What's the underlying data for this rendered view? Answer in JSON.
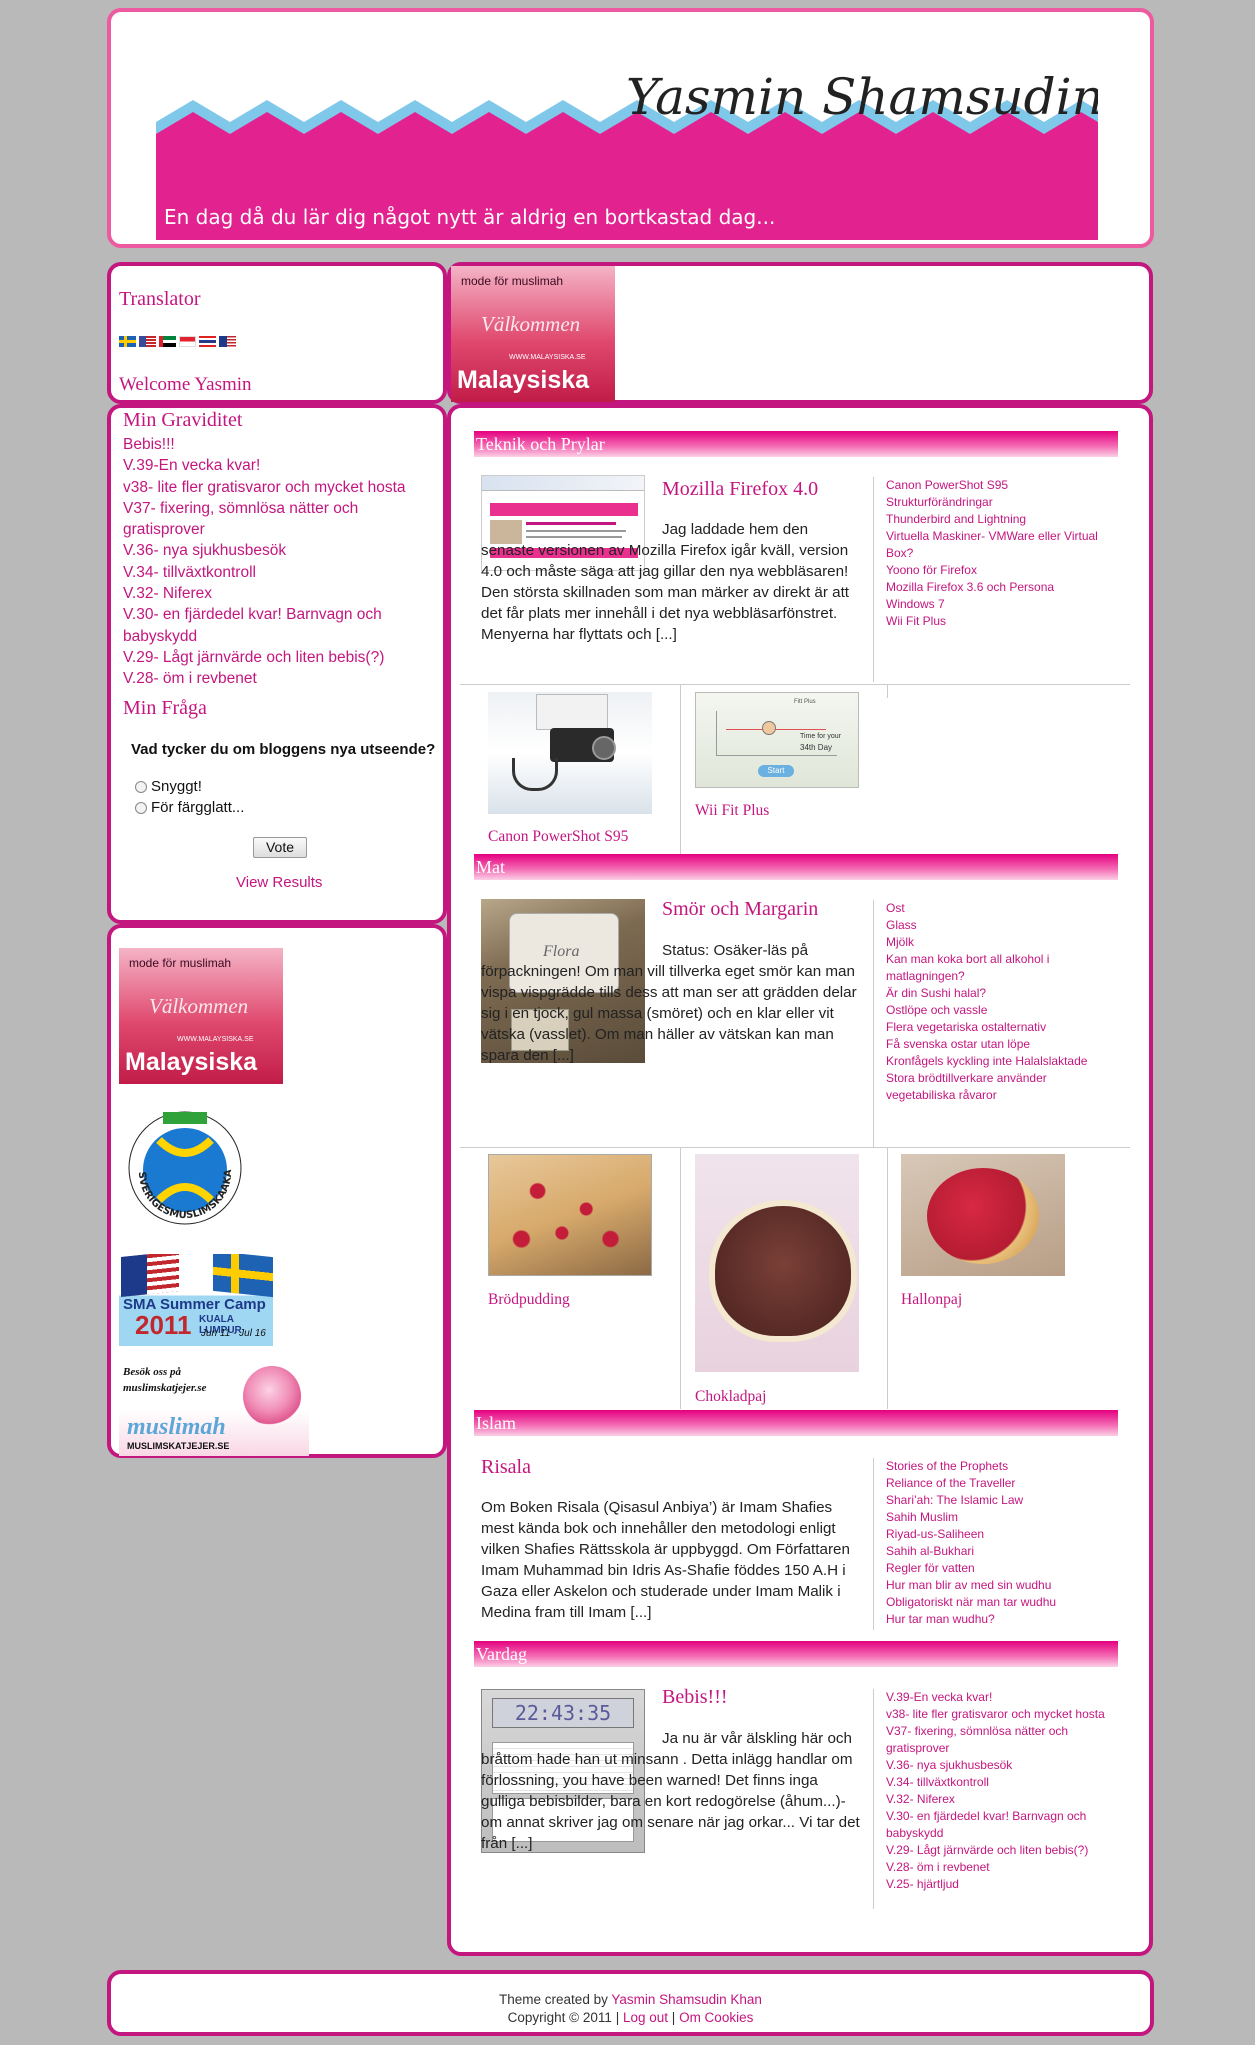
{
  "header": {
    "title": "Yasmin Shamsudin",
    "tagline": "En dag då du lär dig något nytt är aldrig en bortkastad dag...",
    "colors": {
      "pink": "#e2228e",
      "sky": "#7fc8ea"
    }
  },
  "translator": {
    "heading": "Translator",
    "flags": [
      "flag-sweden-icon",
      "flag-usa-icon",
      "flag-uae-icon",
      "flag-indonesia-icon",
      "flag-thailand-icon",
      "flag-malaysia-icon"
    ],
    "welcome": "Welcome Yasmin"
  },
  "ad_top": {
    "line1": "mode för muslimah",
    "line2": "Välkommen",
    "url": "WWW.MALAYSISKA.SE",
    "brand": "Malaysiska"
  },
  "min_graviditet": {
    "heading": "Min Graviditet",
    "items": [
      "Bebis!!!",
      "V.39-En vecka kvar!",
      "v38- lite fler gratisvaror och mycket hosta",
      "V37- fixering, sömnlösa nätter och gratisprover",
      "V.36- nya sjukhusbesök",
      "V.34- tillväxtkontroll",
      "V.32- Niferex",
      "V.30- en fjärdedel kvar! Barnvagn och babyskydd",
      "V.29- Lågt järnvärde och liten bebis(?)",
      "V.28- öm i revbenet"
    ]
  },
  "poll": {
    "heading": "Min Fråga",
    "question": "Vad tycker du om bloggens nya utseende?",
    "options": [
      "Snyggt!",
      "För färgglatt..."
    ],
    "vote_label": "Vote",
    "results_label": "View Results"
  },
  "sidebar_ads": {
    "malaysiska": {
      "line1": "mode för muslimah",
      "line2": "Välkommen",
      "url": "WWW.MALAYSISKA.SE",
      "brand": "Malaysiska"
    },
    "sma_text": "SVERIGESMUSLIMSKAAKADEMIKER",
    "camp": {
      "title": "SMA Summer Camp",
      "year": "2011",
      "place": "KUALA LUMPUR",
      "dates": "Jun 11 - Jul 16"
    },
    "katjejer": {
      "line1": "Besök oss på",
      "line2": "muslimskatjejer.se",
      "brand": "muslimah",
      "url": "MUSLIMSKATJEJER.SE"
    }
  },
  "sections": {
    "teknik": {
      "heading": "Teknik och Prylar",
      "post_title": "Mozilla Firefox 4.0",
      "post_text": "Jag laddade hem den senaste versionen av Mozilla Firefox igår kväll, version 4.0 och måste säga att jag gillar den nya webbläsaren! Den största skillnaden som man märker av direkt är att det får plats mer innehåll i det nya webbläsarfönstret. Menyerna har flyttats och [...]",
      "links": [
        "Canon PowerShot S95",
        "Strukturförändringar",
        "Thunderbird and Lightning",
        "Virtuella Maskiner- VMWare eller Virtual Box?",
        "Yoono för Firefox",
        "Mozilla Firefox 3.6 och Persona",
        "Windows 7",
        "Wii Fit Plus"
      ],
      "thumbs": [
        "Canon PowerShot S95",
        "Wii Fit Plus"
      ],
      "wii_text": {
        "l1": "Fitt Plus",
        "l2": "Time for your",
        "l3": "34th Day",
        "btn": "Start"
      }
    },
    "mat": {
      "heading": "Mat",
      "post_title": "Smör och Margarin",
      "post_text": "Status: Osäker-läs på förpackningen! Om man vill tillverka eget smör kan man vispa vispgrädde tills dess att man ser att grädden delar sig i en tjock, gul massa (smöret) och en klar eller vit vätska (vasslet). Om man häller av vätskan kan man spara den [...]",
      "flora_label": "Flora",
      "links": [
        "Ost",
        "Glass",
        "Mjölk",
        "Kan man koka bort all alkohol i matlagningen?",
        "Är din Sushi halal?",
        "Ostlöpe och vassle",
        "Flera vegetariska ostalternativ",
        "Få svenska ostar utan löpe",
        "Kronfågels kyckling inte Halalslaktade",
        "Stora brödtillverkare använder vegetabiliska råvaror"
      ],
      "thumbs": [
        "Brödpudding",
        "Chokladpaj",
        "Hallonpaj"
      ]
    },
    "islam": {
      "heading": "Islam",
      "post_title": "Risala",
      "post_text": "Om Boken Risala (Qisasul Anbiya’) är Imam Shafies mest kända bok och innehåller den metodologi enligt vilken Shafies Rättsskola är uppbyggd. Om Författaren Imam Muhammad bin Idris As-Shafie föddes 150 A.H i Gaza eller Askelon och studerade under Imam Malik i Medina fram till Imam [...]",
      "links": [
        "Stories of the Prophets",
        "Reliance of the Traveller",
        "Shari’ah: The Islamic Law",
        "Sahih Muslim",
        "Riyad-us-Saliheen",
        "Sahih al-Bukhari",
        "Regler för vatten",
        "Hur man blir av med sin wudhu",
        "Obligatoriskt när man tar wudhu",
        "Hur tar man wudhu?"
      ]
    },
    "vardag": {
      "heading": "Vardag",
      "post_title": "Bebis!!!",
      "post_text": "Ja nu är vår älskling här och bråttom hade han ut minsann . Detta inlägg handlar om förlossning, you have been warned! Det finns inga gulliga bebisbilder, bara en kort redogörelse (åhum...)- om annat skriver jag om senare när jag orkar... Vi tar det från [...]",
      "timer": "22:43:35",
      "links": [
        "V.39-En vecka kvar!",
        "v38- lite fler gratisvaror och mycket hosta",
        "V37- fixering, sömnlösa nätter och gratisprover",
        "V.36- nya sjukhusbesök",
        "V.34- tillväxtkontroll",
        "V.32- Niferex",
        "V.30- en fjärdedel kvar! Barnvagn och babyskydd",
        "V.29- Lågt järnvärde och liten bebis(?)",
        "V.28- öm i revbenet",
        "V.25- hjärtljud"
      ]
    }
  },
  "footer": {
    "theme_prefix": "Theme created by",
    "author": "Yasmin Shamsudin Khan",
    "copyright": "Copyright © 2011",
    "sep": "|",
    "logout": "Log out",
    "cookies": "Om Cookies"
  }
}
